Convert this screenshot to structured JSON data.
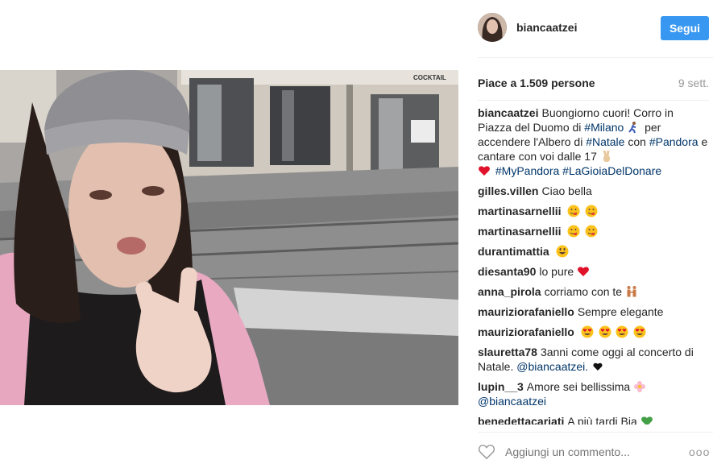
{
  "post": {
    "author": "biancaatzei",
    "follow_label": "Segui",
    "likes_text": "Piace a 1.509 persone",
    "time_text": "9 sett."
  },
  "caption": {
    "user": "biancaatzei",
    "text_1": "Buongiorno cuori! Corro in Piazza del Duomo di",
    "tag_1": "#Milano",
    "text_2": "per accendere l'Albero di",
    "tag_2": "#Natale",
    "text_3": "con",
    "tag_3": "#Pandora",
    "text_4": "e cantare con voi dalle 17",
    "tag_4": "#MyPandora",
    "tag_5": "#LaGioiaDelDonare"
  },
  "comments": [
    {
      "user": "gilles.villen",
      "text": "Ciao bella"
    },
    {
      "user": "martinasarnellii",
      "text": ""
    },
    {
      "user": "martinasarnellii",
      "text": ""
    },
    {
      "user": "durantimattia",
      "text": ""
    },
    {
      "user": "diesanta90",
      "text": "lo pure"
    },
    {
      "user": "anna_pirola",
      "text": "corriamo con te"
    },
    {
      "user": "mauriziorafaniello",
      "text": "Sempre elegante"
    },
    {
      "user": "mauriziorafaniello",
      "text": ""
    },
    {
      "user": "slauretta78",
      "text": "3anni come oggi al concerto di Natale.",
      "mention": "@biancaatzei."
    },
    {
      "user": "lupin__3",
      "text": "Amore sei bellissima",
      "mention": "@biancaatzei"
    },
    {
      "user": "benedettacariati",
      "text": "A più tardi Bia"
    }
  ],
  "photo": {
    "sign_text": "COCKTAIL"
  },
  "footer": {
    "comment_placeholder": "Aggiungi un commento...",
    "more_label": "ooo"
  },
  "colors": {
    "accent": "#3897f0",
    "hashtag": "#003569",
    "muted": "#999999"
  }
}
